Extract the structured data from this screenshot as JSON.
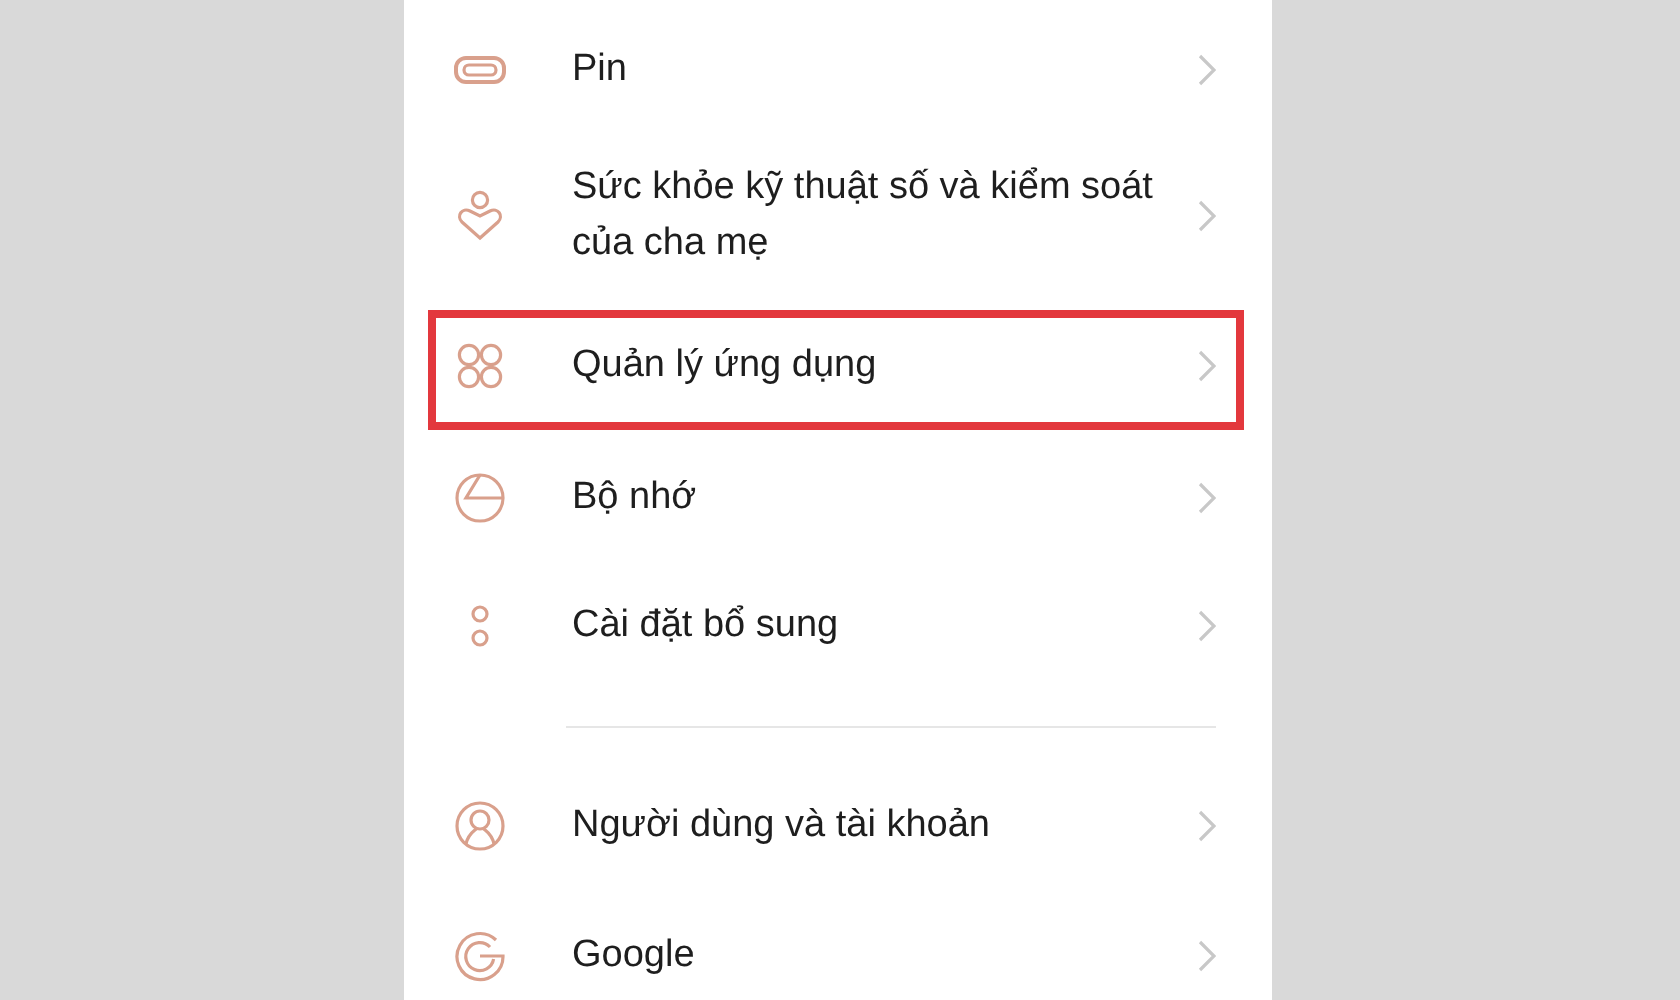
{
  "groups": [
    {
      "items": [
        {
          "label": "Pin",
          "highlighted": false
        },
        {
          "label": "Sức khỏe kỹ thuật số và kiểm soát của cha mẹ",
          "highlighted": false
        },
        {
          "label": "Quản lý ứng dụng",
          "highlighted": true
        },
        {
          "label": "Bộ nhớ",
          "highlighted": false
        },
        {
          "label": "Cài đặt bổ sung",
          "highlighted": false
        }
      ]
    },
    {
      "items": [
        {
          "label": "Người dùng và tài khoản",
          "highlighted": false
        },
        {
          "label": "Google",
          "highlighted": false
        }
      ]
    }
  ]
}
